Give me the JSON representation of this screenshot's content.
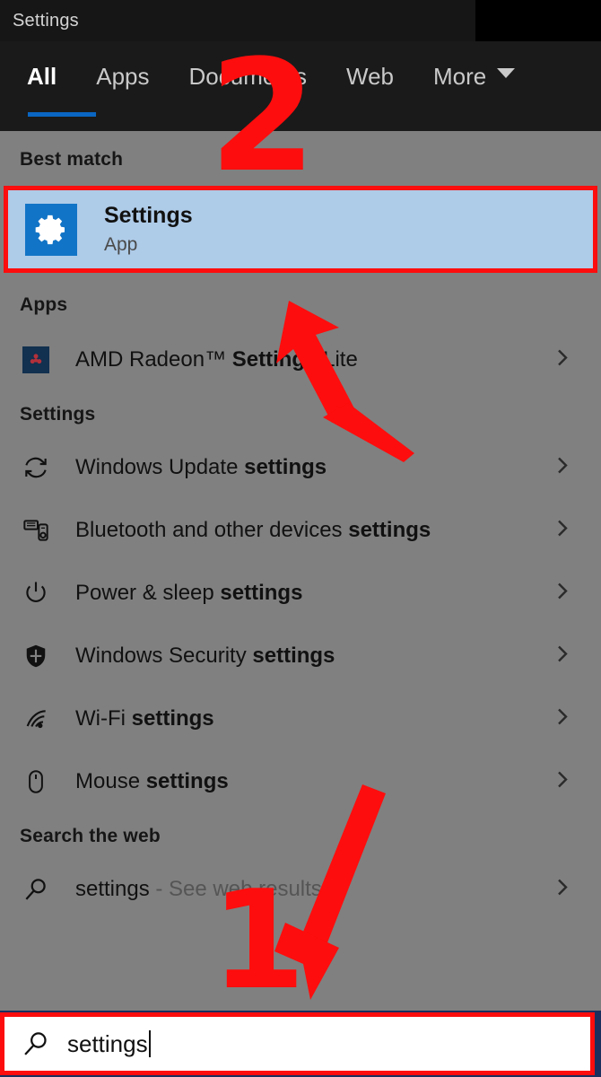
{
  "window": {
    "title": "Settings"
  },
  "tabs": [
    {
      "label": "All",
      "active": true
    },
    {
      "label": "Apps",
      "active": false
    },
    {
      "label": "Documents",
      "active": false
    },
    {
      "label": "Web",
      "active": false
    },
    {
      "label": "More",
      "active": false,
      "icon": "chevron-down-icon"
    }
  ],
  "sections": {
    "best_match_header": "Best match",
    "apps_header": "Apps",
    "settings_header": "Settings",
    "search_web_header": "Search the web"
  },
  "best_match": {
    "title": "Settings",
    "subtitle": "App",
    "icon": "gear-icon",
    "selected": true,
    "highlight_color": "#aecbe8",
    "tile_color": "#1274c6"
  },
  "apps_results": [
    {
      "label_plain": "AMD Radeon™ ",
      "label_bold": "Settings",
      "label_tail": " Lite",
      "icon": "amd-logo-icon",
      "chevron": "chevron-right-icon"
    }
  ],
  "settings_results": [
    {
      "label_plain": "Windows Update ",
      "label_bold": "settings",
      "icon": "refresh-icon",
      "chevron": "chevron-right-icon"
    },
    {
      "label_plain": "Bluetooth and other devices ",
      "label_bold": "settings",
      "icon": "bluetooth-device-icon",
      "chevron": "chevron-right-icon"
    },
    {
      "label_plain": "Power & sleep ",
      "label_bold": "settings",
      "icon": "power-icon",
      "chevron": "chevron-right-icon"
    },
    {
      "label_plain": "Windows Security ",
      "label_bold": "settings",
      "icon": "shield-icon",
      "chevron": "chevron-right-icon"
    },
    {
      "label_plain": "Wi-Fi ",
      "label_bold": "settings",
      "icon": "wifi-icon",
      "chevron": "chevron-right-icon"
    },
    {
      "label_plain": "Mouse ",
      "label_bold": "settings",
      "icon": "mouse-icon",
      "chevron": "chevron-right-icon"
    }
  ],
  "web_results": [
    {
      "label_plain": "settings",
      "label_tail": " - See web results",
      "icon": "search-icon",
      "chevron": "chevron-right-icon"
    }
  ],
  "search": {
    "value": "settings",
    "icon": "search-icon",
    "border_color": "#fd0d0d"
  },
  "annotations": {
    "step_two": "2",
    "step_one": "1",
    "color": "#fd0d0d",
    "arrow_to_best_match": "arrow-up-left-icon",
    "arrow_to_search_box": "arrow-down-icon"
  },
  "colors": {
    "panel_background": "#808080",
    "titlebar": "#161616",
    "tabbar": "#1a1a1a",
    "tab_active_underline": "#0a66c2",
    "annotation_red": "#fd0d0d"
  }
}
